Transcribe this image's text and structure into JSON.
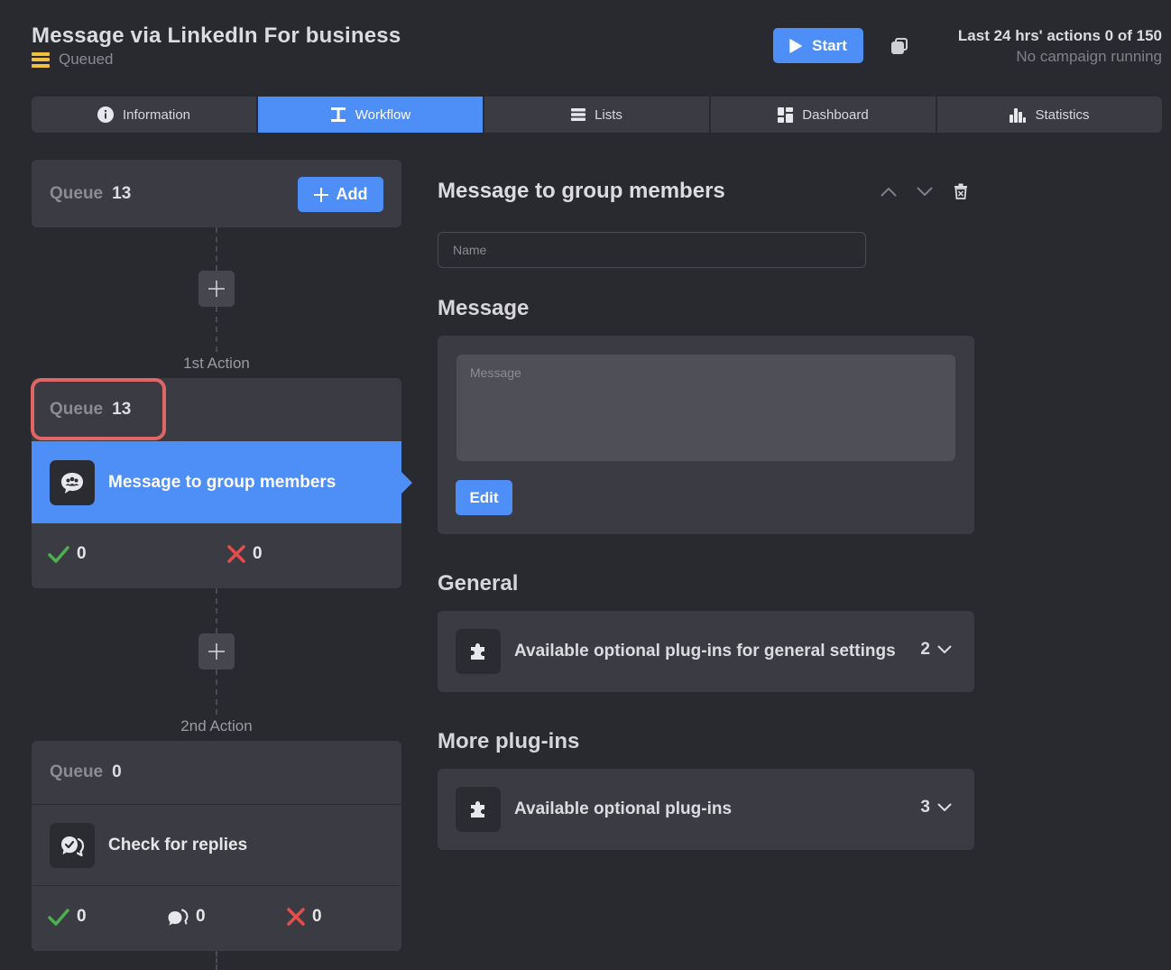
{
  "header": {
    "title": "Message via LinkedIn For business",
    "status": "Queued",
    "start_label": "Start",
    "actions_line1": "Last 24 hrs' actions 0 of 150",
    "actions_line2": "No campaign running"
  },
  "tabs": [
    {
      "label": "Information",
      "icon": "info-icon",
      "active": false
    },
    {
      "label": "Workflow",
      "icon": "workflow-icon",
      "active": true
    },
    {
      "label": "Lists",
      "icon": "list-icon",
      "active": false
    },
    {
      "label": "Dashboard",
      "icon": "dashboard-icon",
      "active": false
    },
    {
      "label": "Statistics",
      "icon": "bar-chart-icon",
      "active": false
    }
  ],
  "workflow": {
    "top_queue": {
      "label": "Queue",
      "count": "13",
      "add_label": "Add"
    },
    "actions": [
      {
        "step_label": "1st Action",
        "queue_label": "Queue",
        "queue_count": "13",
        "name": "Message to group members",
        "icon": "group-message-icon",
        "success_count": "0",
        "fail_count": "0"
      },
      {
        "step_label": "2nd Action",
        "queue_label": "Queue",
        "queue_count": "0",
        "name": "Check for replies",
        "icon": "check-replies-icon",
        "success_count": "0",
        "reply_count": "0",
        "fail_count": "0"
      }
    ]
  },
  "detail": {
    "title": "Message to group members",
    "name_placeholder": "Name",
    "message_section": "Message",
    "message_placeholder": "Message",
    "edit_label": "Edit",
    "general_section": "General",
    "general_plugins_label": "Available optional plug-ins for general settings",
    "general_plugins_count": "2",
    "more_section": "More plug-ins",
    "more_plugins_label": "Available optional plug-ins",
    "more_plugins_count": "3"
  },
  "colors": {
    "background": "#292a2f",
    "card": "#3b3c43",
    "accent": "#4d8ef7",
    "success": "#4caf50",
    "fail": "#e74c4c",
    "highlight": "#e06565",
    "queued": "#f0c040"
  }
}
